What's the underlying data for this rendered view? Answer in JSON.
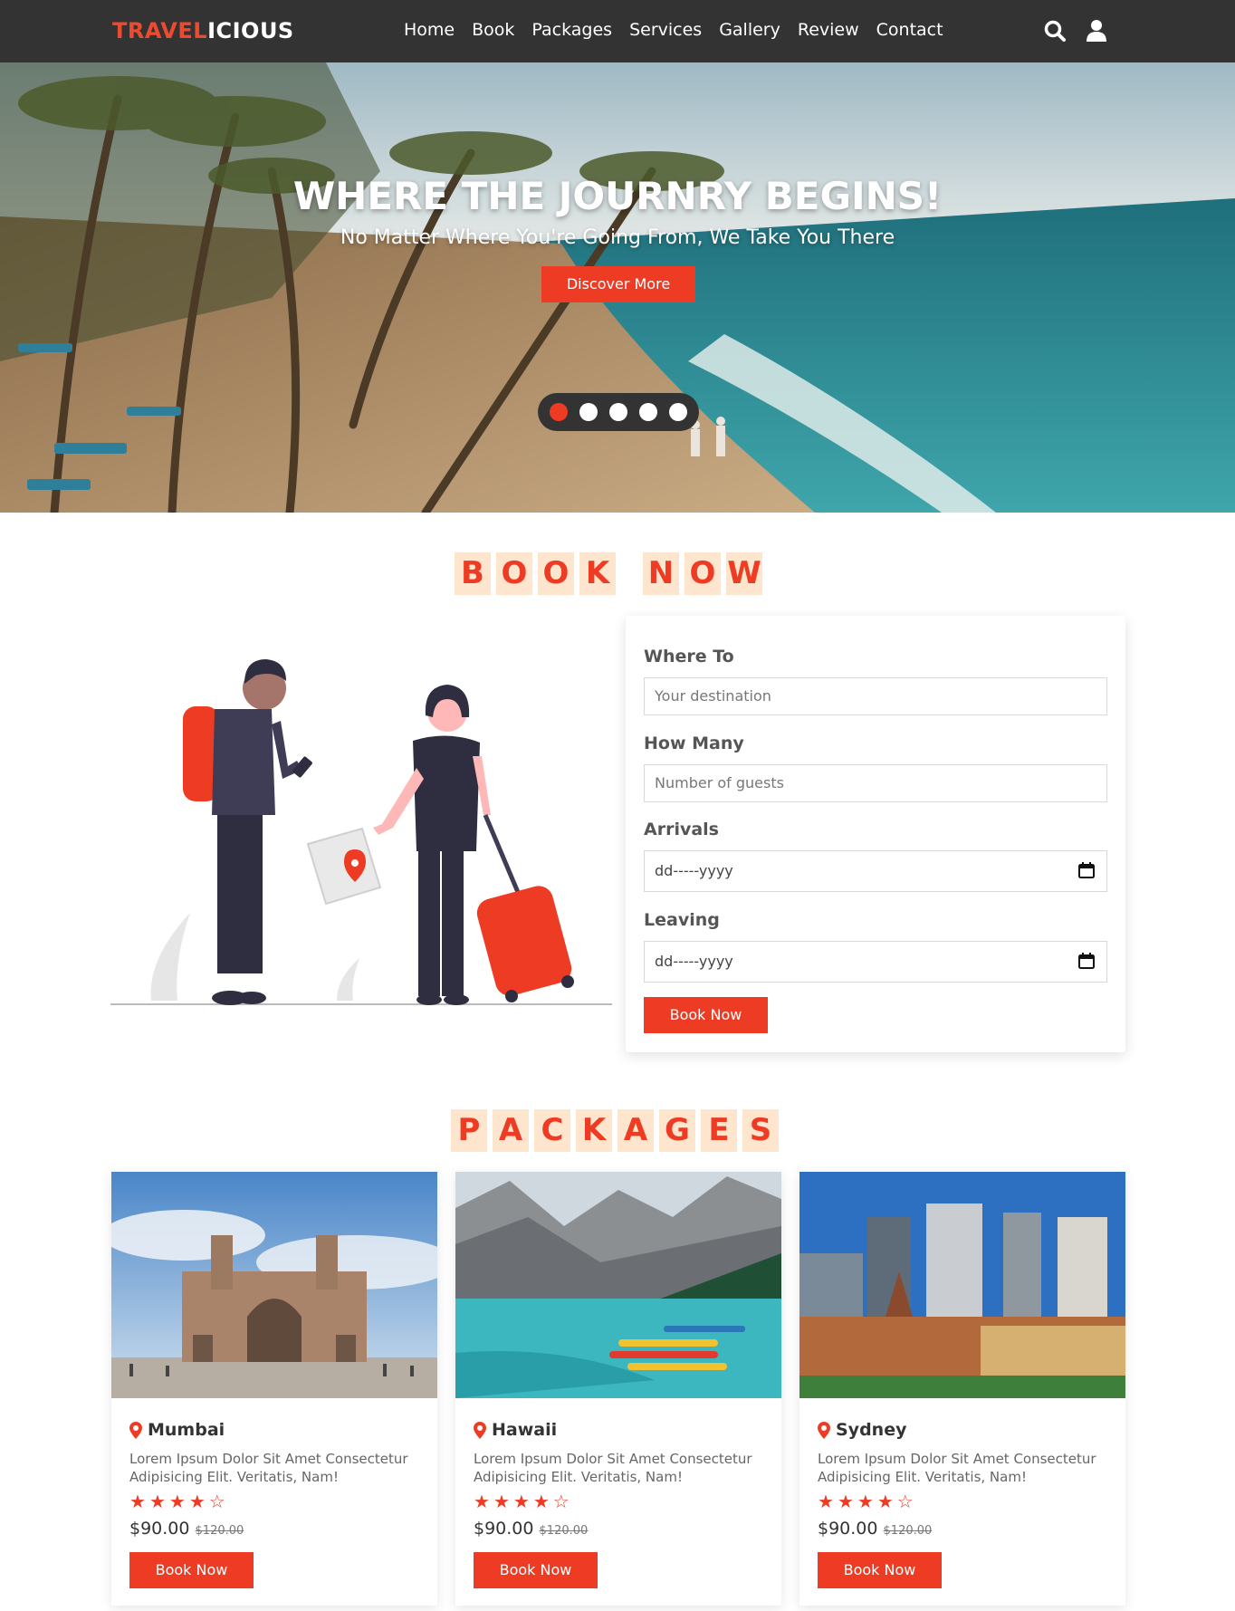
{
  "brand": {
    "part1": "TRAVEL",
    "part2": "ICIOUS",
    "accent_color": "#ee3b24",
    "dark_color": "#333333"
  },
  "nav": {
    "links": [
      "Home",
      "Book",
      "Packages",
      "Services",
      "Gallery",
      "Review",
      "Contact"
    ],
    "icons": [
      "search-icon",
      "user-icon"
    ]
  },
  "hero": {
    "title": "WHERE THE JOURNRY BEGINS!",
    "subtitle": "No Matter Where You're Going From, We Take You There",
    "button": "Discover More",
    "slide_count": 5,
    "active_slide": 1
  },
  "book_section": {
    "heading_words": [
      "BOOK",
      "NOW"
    ],
    "fields": [
      {
        "label": "Where To",
        "placeholder": "Your destination"
      },
      {
        "label": "How Many",
        "placeholder": "Number of guests"
      },
      {
        "label": "Arrivals",
        "placeholder": "dd-----yyyy",
        "icon": "calendar-icon"
      },
      {
        "label": "Leaving",
        "placeholder": "dd-----yyyy",
        "icon": "calendar-icon"
      }
    ],
    "submit": "Book Now"
  },
  "packages": {
    "heading_words": [
      "PACKAGES"
    ],
    "cards": [
      {
        "place": "Mumbai",
        "description": "Lorem Ipsum Dolor Sit Amet Consectetur Adipisicing Elit. Veritatis, Nam!",
        "rating": 4,
        "max_rating": 5,
        "price": "$90.00",
        "old_price": "$120.00",
        "button": "Book Now"
      },
      {
        "place": "Hawaii",
        "description": "Lorem Ipsum Dolor Sit Amet Consectetur Adipisicing Elit. Veritatis, Nam!",
        "rating": 4,
        "max_rating": 5,
        "price": "$90.00",
        "old_price": "$120.00",
        "button": "Book Now"
      },
      {
        "place": "Sydney",
        "description": "Lorem Ipsum Dolor Sit Amet Consectetur Adipisicing Elit. Veritatis, Nam!",
        "rating": 4,
        "max_rating": 5,
        "price": "$90.00",
        "old_price": "$120.00",
        "button": "Book Now"
      }
    ]
  }
}
